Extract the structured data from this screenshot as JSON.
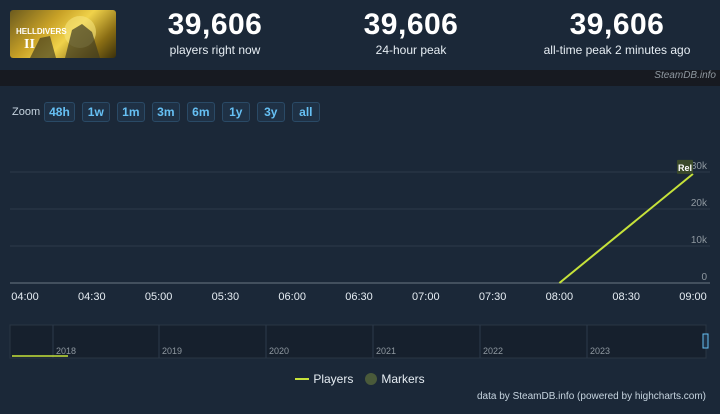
{
  "header": {
    "game_image_alt": "HELLDIVERS II",
    "stats": [
      {
        "value": "39,606",
        "label": "players right now"
      },
      {
        "value": "39,606",
        "label": "24-hour peak"
      },
      {
        "value": "39,606",
        "label": "all-time peak 2 minutes ago"
      }
    ],
    "credit": "SteamDB.info"
  },
  "zoom": {
    "label": "Zoom",
    "buttons": [
      "48h",
      "1w",
      "1m",
      "3m",
      "6m",
      "1y",
      "3y",
      "all"
    ]
  },
  "chart_data": {
    "type": "line",
    "x": [
      "08:00",
      "09:00"
    ],
    "series": [
      {
        "name": "Players",
        "values": [
          0,
          29500
        ],
        "color": "#c6e23a"
      }
    ],
    "x_ticks": [
      "04:00",
      "04:30",
      "05:00",
      "05:30",
      "06:00",
      "06:30",
      "07:00",
      "07:30",
      "08:00",
      "08:30",
      "09:00"
    ],
    "y_ticks": [
      0,
      10000,
      20000,
      30000
    ],
    "y_tick_labels": [
      "0",
      "10k",
      "20k",
      "30k"
    ],
    "xlim": [
      "04:00",
      "09:00"
    ],
    "ylim": [
      0,
      30000
    ],
    "grid": true,
    "annotations": [
      {
        "x": "09:00",
        "text": "Rel"
      }
    ],
    "navigator": {
      "x_ticks": [
        "2018",
        "2019",
        "2020",
        "2021",
        "2022",
        "2023"
      ]
    },
    "legend": [
      {
        "name": "Players",
        "color": "#c6e23a"
      },
      {
        "name": "Markers",
        "color": "#4a5a3a"
      }
    ]
  },
  "footer": "data by SteamDB.info (powered by highcharts.com)"
}
